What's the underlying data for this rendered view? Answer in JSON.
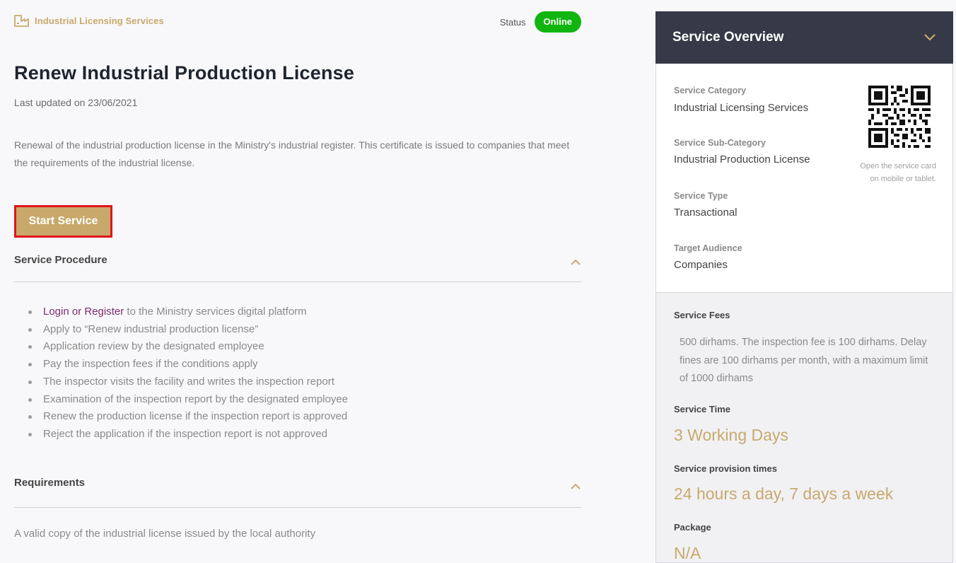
{
  "header": {
    "breadcrumb": "Industrial Licensing Services",
    "status_label": "Status",
    "status_value": "Online",
    "status_color": "#10b510"
  },
  "service": {
    "title": "Renew Industrial Production License",
    "last_updated": "Last updated on 23/06/2021",
    "description": "Renewal of the industrial production license in the Ministry's industrial register. This certificate is issued to companies that meet the requirements of the industrial license.",
    "start_button": "Start Service"
  },
  "procedure": {
    "title": "Service Procedure",
    "first_link": "Login or Register",
    "first_rest": " to the Ministry services digital platform",
    "steps": [
      "Apply to “Renew industrial production license”",
      "Application review by the designated employee",
      "Pay the inspection fees if the conditions apply",
      "The inspector visits the facility and writes the inspection report",
      "Examination of the inspection report by the designated employee",
      "Renew the production license if the inspection report is approved",
      "Reject the application if the inspection report is not approved"
    ]
  },
  "requirements": {
    "title": "Requirements",
    "item": "A valid copy of the industrial license issued by the local authority"
  },
  "overview": {
    "title": "Service Overview",
    "category_label": "Service Category",
    "category_value": "Industrial Licensing Services",
    "subcategory_label": "Service Sub-Category",
    "subcategory_value": "Industrial Production License",
    "type_label": "Service Type",
    "type_value": "Transactional",
    "audience_label": "Target Audience",
    "audience_value": "Companies",
    "qr_caption": "Open the service card on mobile or tablet.",
    "fees_label": "Service Fees",
    "fees_text": "500 dirhams. The inspection fee is 100 dirhams. Delay fines are 100 dirhams per month, with a maximum limit of 1000 dirhams",
    "time_label": "Service Time",
    "time_value": "3 Working Days",
    "provision_label": "Service provision times",
    "provision_value": "24 hours a day, 7 days a week",
    "package_label": "Package",
    "package_value": "N/A"
  },
  "colors": {
    "gold": "#c8a96b",
    "dark": "#363a48",
    "link": "#7c2d6b",
    "highlight_border": "#e0141b"
  }
}
